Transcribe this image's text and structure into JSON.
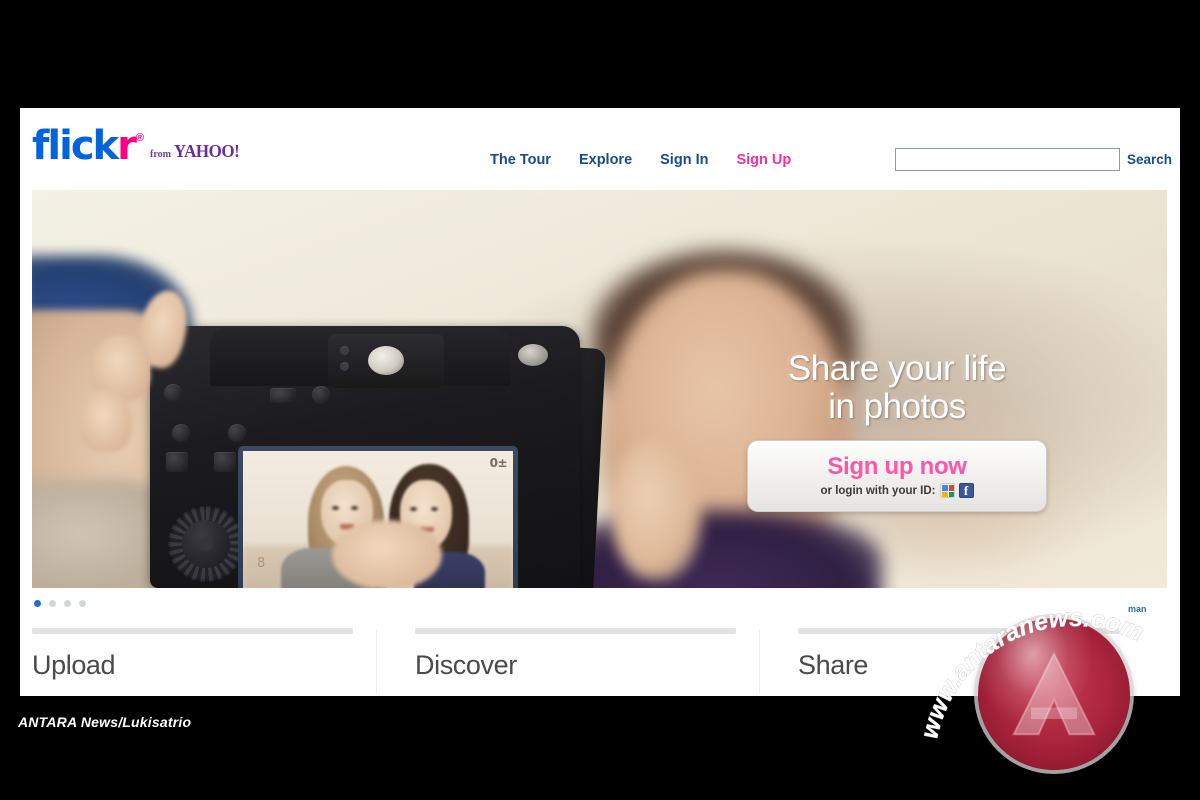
{
  "site": {
    "logo": {
      "brand_primary": "flick",
      "brand_accent": "r",
      "registered_mark": "®",
      "byline_from": "from",
      "byline_brand": "YAHOO!",
      "color_blue": "#0063DC",
      "color_pink": "#FF0084"
    }
  },
  "nav": {
    "items": [
      {
        "label": "The Tour",
        "accent": false
      },
      {
        "label": "Explore",
        "accent": false
      },
      {
        "label": "Sign In",
        "accent": false
      },
      {
        "label": "Sign Up",
        "accent": true
      }
    ]
  },
  "search": {
    "value": "",
    "placeholder": "",
    "button_label": "Search"
  },
  "hero": {
    "headline_line1": "Share your life",
    "headline_line2": "in photos",
    "signup_button": "Sign up now",
    "signup_subtext": "or login with your ID:",
    "id_providers": [
      "google-icon",
      "facebook-icon"
    ],
    "facebook_glyph": "f",
    "lcd_overlay": {
      "exposure": "0±",
      "counter": "8"
    },
    "image_description": "Hand holding a DSLR camera showing a selfie of two young women on the LCD screen, blurred girl in the background"
  },
  "carousel": {
    "slide_count": 4,
    "active_index": 0
  },
  "features": {
    "columns": [
      {
        "title": "Upload"
      },
      {
        "title": "Discover"
      },
      {
        "title": "Share"
      }
    ]
  },
  "watermark": {
    "arc_text": "www.antaranews.com",
    "sub_text": "man",
    "badge_color": "#A8243C"
  },
  "caption": {
    "text": "ANTARA News/Lukisatrio"
  }
}
